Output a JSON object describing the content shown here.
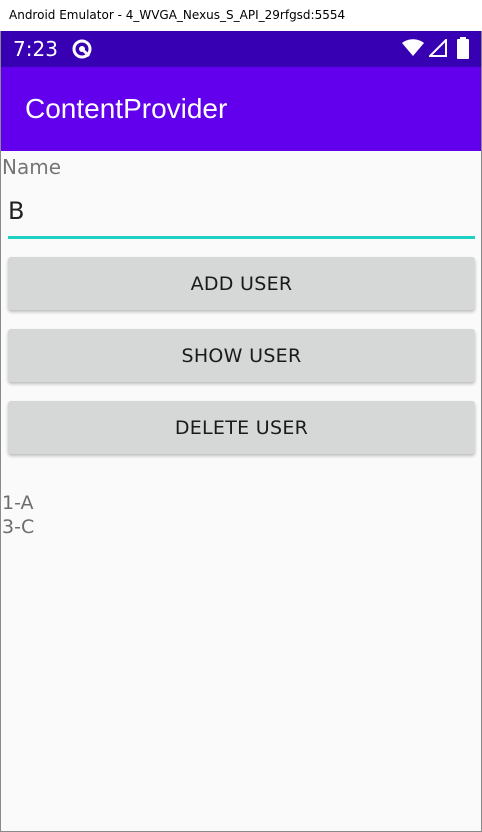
{
  "window": {
    "title": "Android Emulator - 4_WVGA_Nexus_S_API_29rfgsd:5554"
  },
  "status_bar": {
    "time": "7:23",
    "icons": [
      "app-notification-icon",
      "wifi-icon",
      "cell-signal-icon",
      "battery-icon"
    ]
  },
  "app_bar": {
    "title": "ContentProvider"
  },
  "form": {
    "name_label": "Name",
    "name_value": "B"
  },
  "buttons": {
    "add_user": "ADD USER",
    "show_user": "SHOW USER",
    "delete_user": "DELETE USER"
  },
  "users": [
    "1-A",
    "3-C"
  ],
  "colors": {
    "status_bar": "#3700b3",
    "app_bar": "#6200ee",
    "accent": "#1fd1c3",
    "button": "#d6d7d7",
    "background": "#fafafa"
  }
}
